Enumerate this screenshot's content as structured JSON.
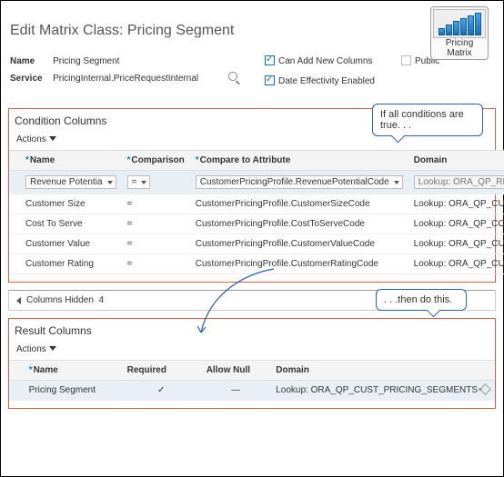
{
  "header": {
    "title": "Edit Matrix Class: Pricing Segment"
  },
  "badge": {
    "line1": "Pricing",
    "line2": "Matrix"
  },
  "attrs": {
    "name_label": "Name",
    "name_value": "Pricing Segment",
    "service_label": "Service",
    "service_value": "PricingInternal.PriceRequestInternal",
    "can_add": "Can Add New Columns",
    "date_eff": "Date Effectivity Enabled",
    "public": "Public"
  },
  "callouts": {
    "c1": "If all conditions are true. . .",
    "c2": ". . .then do this."
  },
  "condition": {
    "title": "Condition Columns",
    "actions": "Actions",
    "headers": {
      "name": "Name",
      "comparison": "Comparison",
      "compare": "Compare to Attribute",
      "domain": "Domain"
    },
    "rows": [
      {
        "name": "Revenue Potentia",
        "cmp": "=",
        "attr": "CustomerPricingProfile.RevenuePotentialCode",
        "domain": "Lookup: ORA_QP_REV_POTENTIAL_VALU"
      },
      {
        "name": "Customer Size",
        "cmp": "=",
        "attr": "CustomerPricingProfile.CustomerSizeCode",
        "domain": "Lookup: ORA_QP_CUSTOMER_SIZE_VALUES"
      },
      {
        "name": "Cost To Serve",
        "cmp": "=",
        "attr": "CustomerPricingProfile.CostToServeCode",
        "domain": "Lookup: ORA_QP_COST_TO_SERVE"
      },
      {
        "name": "Customer Value",
        "cmp": "=",
        "attr": "CustomerPricingProfile.CustomerValueCode",
        "domain": "Lookup: ORA_QP_CUSTOMER_VALUE_RANKINGS"
      },
      {
        "name": "Customer Rating",
        "cmp": "=",
        "attr": "CustomerPricingProfile.CustomerRatingCode",
        "domain": "Lookup: ORA_QP_CUSTOMER_RATING_VALUES"
      }
    ]
  },
  "hidden": {
    "label": "Columns Hidden",
    "count": "4"
  },
  "result": {
    "title": "Result Columns",
    "actions": "Actions",
    "headers": {
      "name": "Name",
      "required": "Required",
      "allownull": "Allow Null",
      "domain": "Domain"
    },
    "rows": [
      {
        "name": "Pricing Segment",
        "required": "✓",
        "allownull": "—",
        "domain": "Lookup: ORA_QP_CUST_PRICING_SEGMENTS"
      }
    ]
  }
}
